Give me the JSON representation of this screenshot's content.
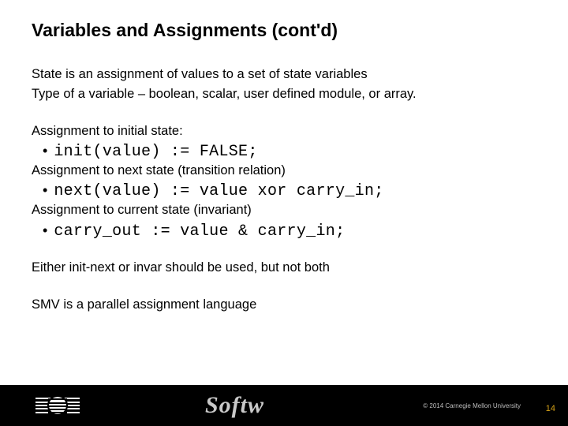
{
  "title": "Variables and Assignments (cont'd)",
  "lines": {
    "p1": "State is an assignment of values to a set of state variables",
    "p2": "Type of a variable – boolean, scalar, user defined module, or array.",
    "p3": "Assignment to initial state:",
    "code1": "init(value) := FALSE;",
    "p4": "Assignment to next state (transition relation)",
    "code2": "next(value) := value xor carry_in;",
    "p5": "Assignment to current state (invariant)",
    "code3": "carry_out := value & carry_in;",
    "p6": "Either init-next or invar should be used, but not both",
    "p7": "SMV is a parallel assignment language"
  },
  "footer": {
    "brand": "Softw",
    "copyright": "© 2014 Carnegie Mellon University",
    "page": "14"
  }
}
